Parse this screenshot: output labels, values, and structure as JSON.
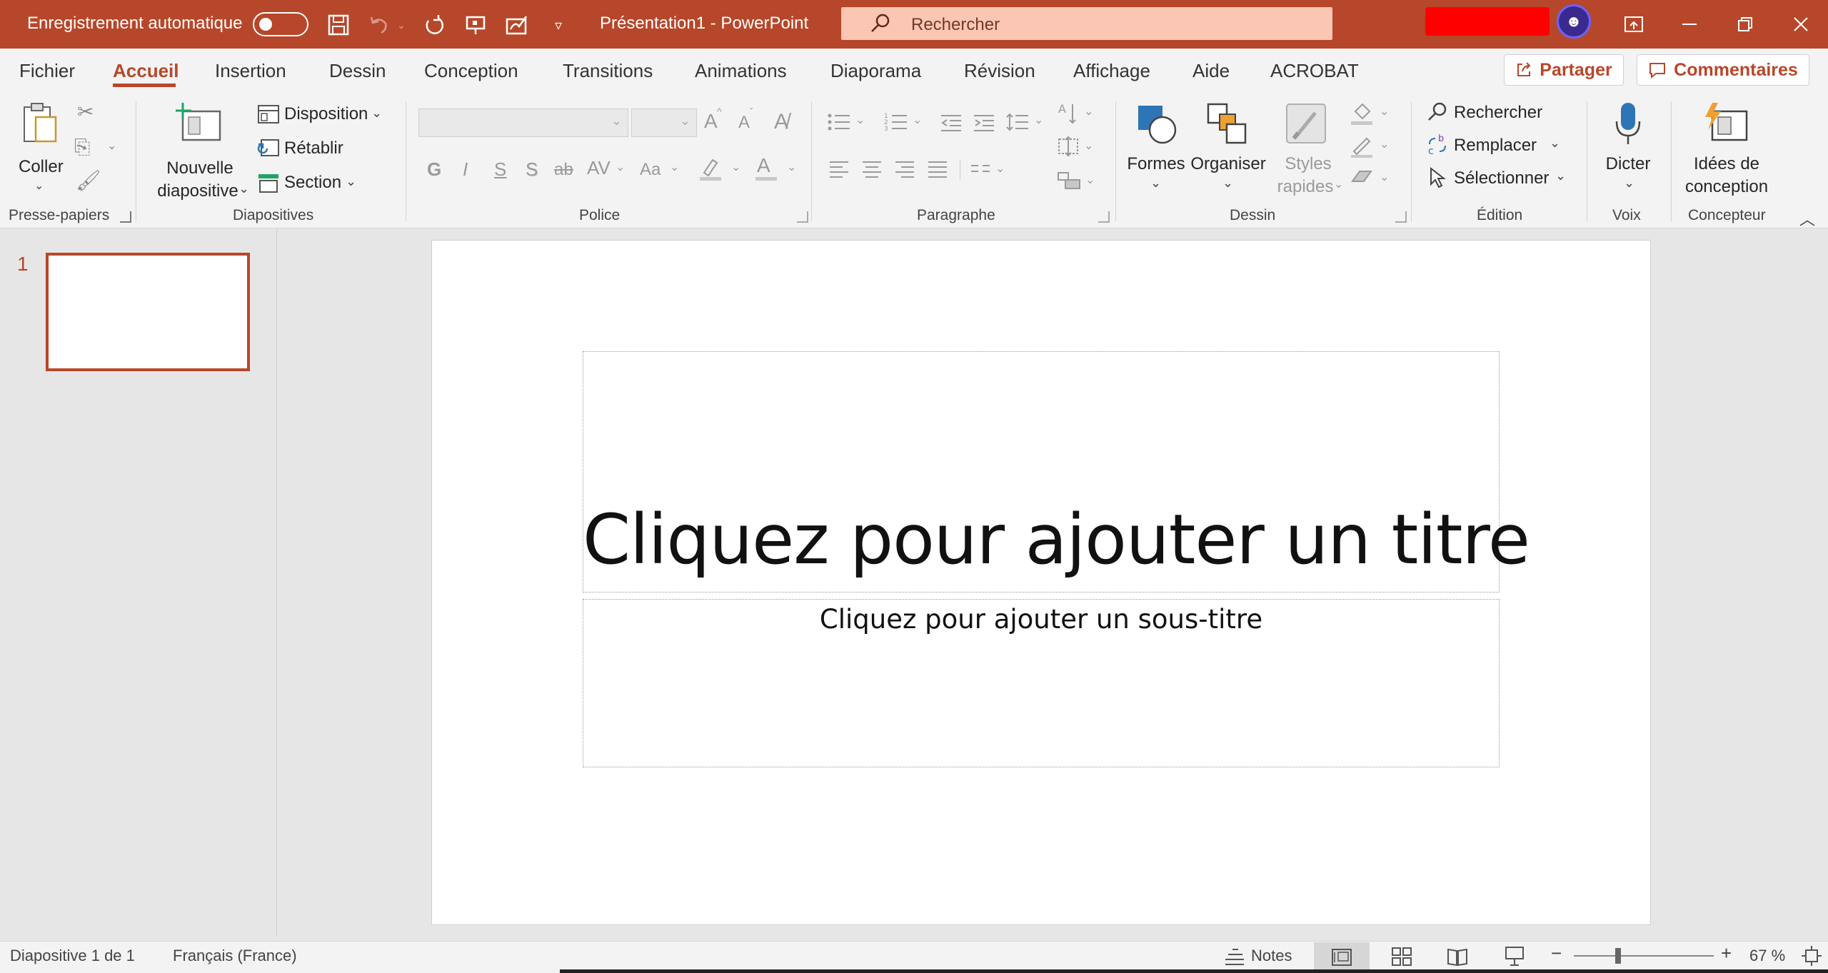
{
  "titlebar": {
    "autosave_label": "Enregistrement automatique",
    "doc_title": "Présentation1  -  PowerPoint",
    "search_placeholder": "Rechercher",
    "accent_color": "#b7472a"
  },
  "tabs": [
    {
      "label": "Fichier"
    },
    {
      "label": "Accueil"
    },
    {
      "label": "Insertion"
    },
    {
      "label": "Dessin"
    },
    {
      "label": "Conception"
    },
    {
      "label": "Transitions"
    },
    {
      "label": "Animations"
    },
    {
      "label": "Diaporama"
    },
    {
      "label": "Révision"
    },
    {
      "label": "Affichage"
    },
    {
      "label": "Aide"
    },
    {
      "label": "ACROBAT"
    }
  ],
  "actions": {
    "share": "Partager",
    "comments": "Commentaires"
  },
  "ribbon": {
    "clipboard": {
      "paste": "Coller",
      "group": "Presse-papiers"
    },
    "slides": {
      "new_line1": "Nouvelle",
      "new_line2": "diapositive",
      "layout": "Disposition",
      "reset": "Rétablir",
      "section": "Section",
      "group": "Diapositives"
    },
    "font": {
      "bold": "G",
      "italic": "I",
      "underline": "S",
      "shadow": "S",
      "strike": "ab",
      "spacing": "AV",
      "case": "Aa",
      "grow": "A",
      "shrink": "A",
      "group": "Police"
    },
    "paragraph": {
      "group": "Paragraphe"
    },
    "drawing": {
      "shapes": "Formes",
      "arrange": "Organiser",
      "styles_line1": "Styles",
      "styles_line2": "rapides",
      "group": "Dessin"
    },
    "editing": {
      "find": "Rechercher",
      "replace": "Remplacer",
      "select": "Sélectionner",
      "group": "Édition"
    },
    "voice": {
      "dictate": "Dicter",
      "group": "Voix"
    },
    "designer": {
      "ideas_line1": "Idées de",
      "ideas_line2": "conception",
      "group": "Concepteur"
    }
  },
  "thumbs": {
    "slide_number": "1"
  },
  "slide": {
    "title_placeholder": "Cliquez pour ajouter un titre",
    "subtitle_placeholder": "Cliquez pour ajouter un sous-titre"
  },
  "status": {
    "slide_info": "Diapositive 1 de 1",
    "language": "Français (France)",
    "notes": "Notes",
    "zoom_percent": "67 %",
    "zoom_minus": "−",
    "zoom_plus": "+"
  }
}
